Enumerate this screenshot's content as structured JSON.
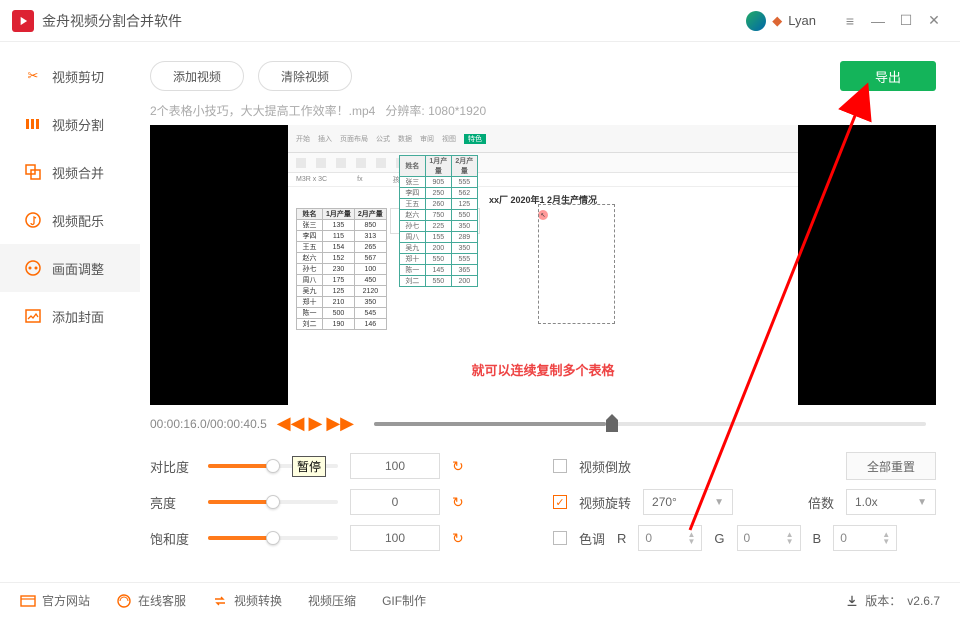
{
  "titlebar": {
    "app_title": "金舟视频分割合并软件",
    "username": "Lyan"
  },
  "sidebar": {
    "items": [
      {
        "label": "视频剪切"
      },
      {
        "label": "视频分割"
      },
      {
        "label": "视频合并"
      },
      {
        "label": "视频配乐"
      },
      {
        "label": "画面调整"
      },
      {
        "label": "添加封面"
      }
    ]
  },
  "toolbar": {
    "add_video": "添加视频",
    "clear_video": "清除视频",
    "export": "导出"
  },
  "file": {
    "name": "2个表格小技巧，大大提高工作效率！.mp4",
    "res_label": "分辨率:",
    "res_value": "1080*1920"
  },
  "preview": {
    "sheet_title": "xx厂 2020年1 2月生产情况",
    "caption": "就可以连续复制多个表格",
    "cellbar_name": "M3R x 3C",
    "cellbar_fx": "fx",
    "cellbar_val": "孩名"
  },
  "playback": {
    "time": "00:00:16.0/00:00:40.5",
    "tooltip": "暂停"
  },
  "adjust": {
    "contrast_label": "对比度",
    "contrast_value": "100",
    "brightness_label": "亮度",
    "brightness_value": "0",
    "saturation_label": "饱和度",
    "saturation_value": "100",
    "reverse_label": "视频倒放",
    "rotate_label": "视频旋转",
    "rotate_value": "270°",
    "speed_label": "倍数",
    "speed_value": "1.0x",
    "hue_label": "色调",
    "r_label": "R",
    "r_value": "0",
    "g_label": "G",
    "g_value": "0",
    "b_label": "B",
    "b_value": "0",
    "reset_all": "全部重置"
  },
  "footer": {
    "site": "官方网站",
    "support": "在线客服",
    "convert": "视频转换",
    "compress": "视频压缩",
    "gif": "GIF制作",
    "version_label": "版本：",
    "version_value": "v2.6.7"
  }
}
